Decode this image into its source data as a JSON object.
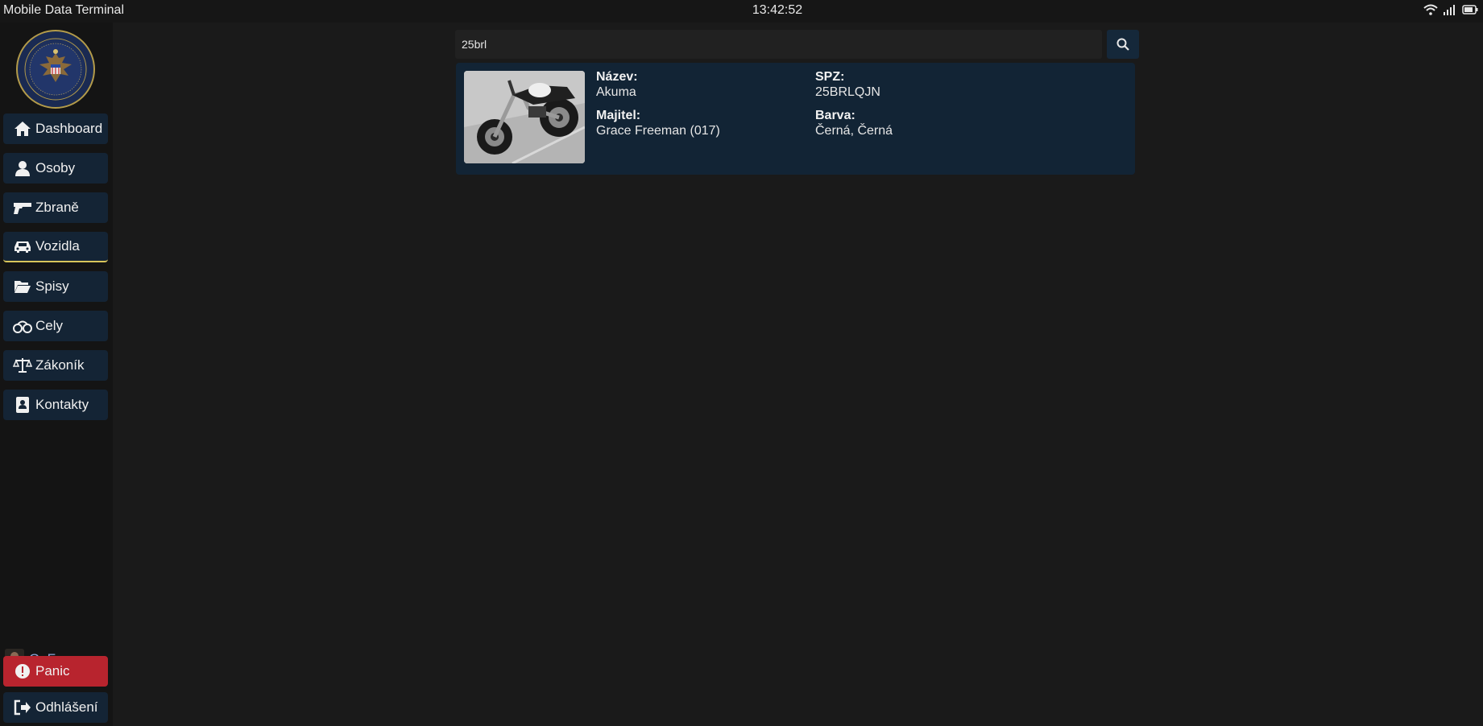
{
  "window": {
    "title": "Mobile Data Terminal",
    "clock": "13:42:52"
  },
  "sidebar": {
    "items": [
      {
        "label": "Dashboard",
        "icon": "home-icon"
      },
      {
        "label": "Osoby",
        "icon": "person-icon"
      },
      {
        "label": "Zbraně",
        "icon": "gun-icon"
      },
      {
        "label": "Vozidla",
        "icon": "car-icon",
        "active": true
      },
      {
        "label": "Spisy",
        "icon": "folder-icon"
      },
      {
        "label": "Cely",
        "icon": "handcuffs-icon"
      },
      {
        "label": "Zákoník",
        "icon": "scales-icon"
      },
      {
        "label": "Kontakty",
        "icon": "contact-book-icon"
      }
    ],
    "user_name": "G. Freeman",
    "panic_label": "Panic",
    "logout_label": "Odhlášení"
  },
  "search": {
    "value": "25brl"
  },
  "result": {
    "name_label": "Název:",
    "name_value": "Akuma",
    "owner_label": "Majitel:",
    "owner_value": "Grace Freeman (017)",
    "plate_label": "SPZ:",
    "plate_value": "25BRLQJN",
    "color_label": "Barva:",
    "color_value": "Černá, Černá"
  },
  "colors": {
    "accent": "#d9c55a",
    "nav_bg": "#142435",
    "panic": "#b8242e",
    "card_bg": "#122435"
  }
}
